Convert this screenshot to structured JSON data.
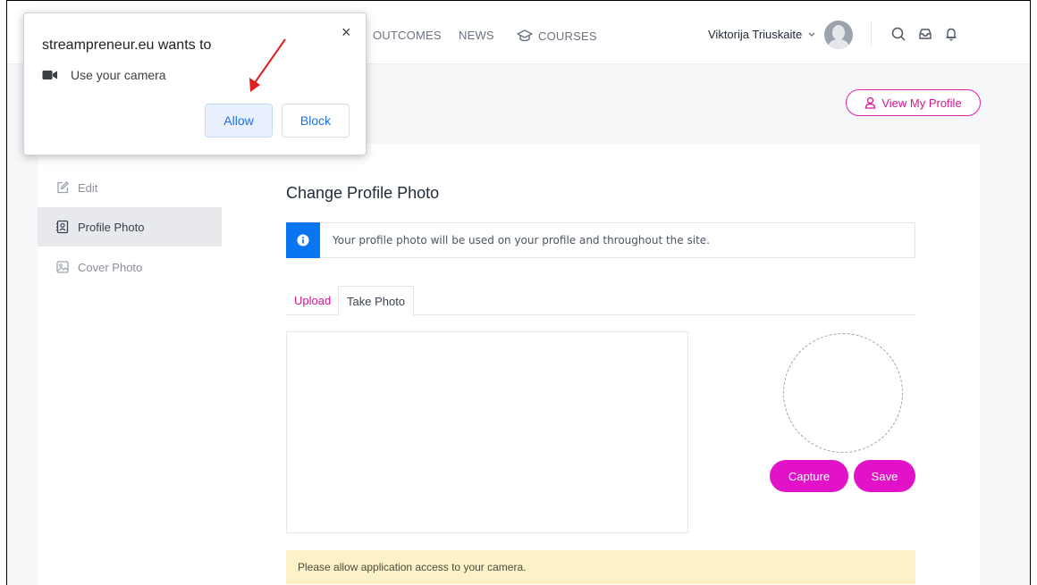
{
  "header": {
    "nav": [
      {
        "label": "OUTCOMES"
      },
      {
        "label": "NEWS"
      },
      {
        "label": "COURSES",
        "icon": "graduation-cap-icon"
      }
    ],
    "user_name": "Viktorija Triuskaite"
  },
  "profile_header": {
    "view_profile_label": "View My Profile"
  },
  "sidebar": {
    "items": [
      {
        "label": "Edit",
        "icon": "edit-icon",
        "active": false
      },
      {
        "label": "Profile Photo",
        "icon": "profile-photo-icon",
        "active": true
      },
      {
        "label": "Cover Photo",
        "icon": "image-icon",
        "active": false
      }
    ]
  },
  "main": {
    "title": "Change Profile Photo",
    "info_text": "Your profile photo will be used on your profile and throughout the site.",
    "tabs": [
      {
        "label": "Upload",
        "active": false
      },
      {
        "label": "Take Photo",
        "active": true
      }
    ],
    "capture_label": "Capture",
    "save_label": "Save",
    "warning_text": "Please allow application access to your camera."
  },
  "popup": {
    "title": "streampreneur.eu wants to",
    "permission": "Use your camera",
    "allow_label": "Allow",
    "block_label": "Block",
    "close_symbol": "×"
  },
  "colors": {
    "accent": "#e112c8",
    "info_blue": "#0a75f0",
    "warning_bg": "#fdf1c7",
    "popup_blue": "#1a73e8"
  }
}
